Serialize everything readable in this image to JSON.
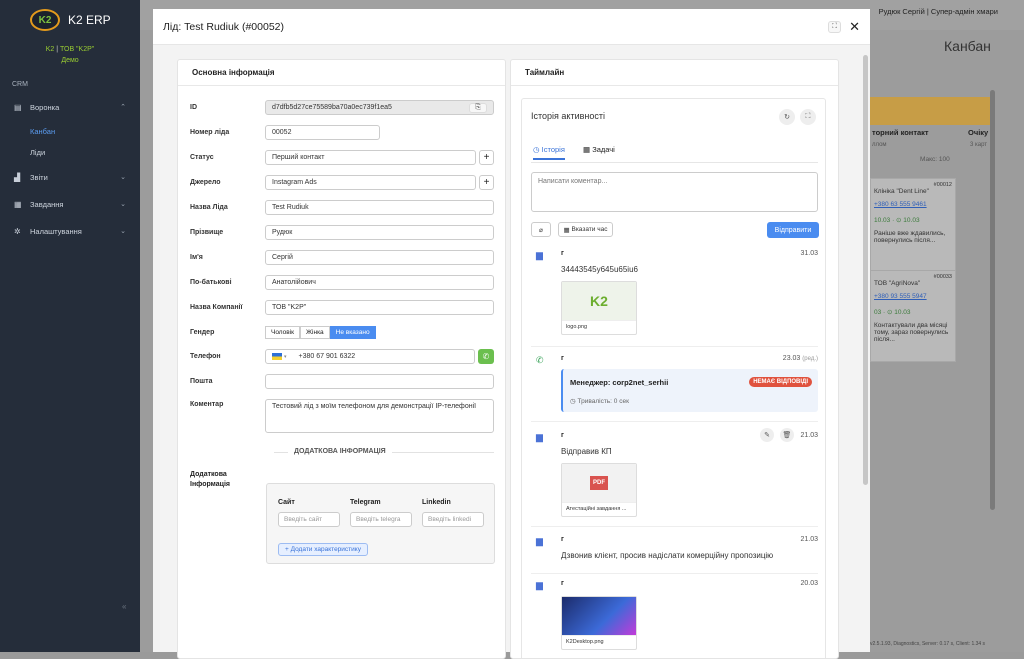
{
  "app": {
    "name": "K2 ERP",
    "org_code": "K2",
    "org_sep": "|",
    "org_name": "ТОВ \"K2P\"",
    "org_mode": "Демо",
    "user": "Рудюк Сергій | Супер-адмін хмари"
  },
  "sidebar": {
    "section": "CRM",
    "items": [
      {
        "label": "Воронка",
        "icon": "funnel-icon"
      },
      {
        "label": "Канбан"
      },
      {
        "label": "Ліди"
      },
      {
        "label": "Звіти",
        "icon": "chart-icon"
      },
      {
        "label": "Завдання",
        "icon": "calendar-icon"
      },
      {
        "label": "Налаштування",
        "icon": "gear-icon"
      }
    ]
  },
  "background": {
    "title": "Канбан",
    "col1": "торний контакт",
    "col1_sub": "ллом",
    "col1_max": "Макс: 100",
    "col2": "Очіку",
    "col2_sub": "3 карт",
    "cards": [
      {
        "id": "#00012",
        "name": "Клініка \"Dent Line\"",
        "phone": "+380 63 555 9461",
        "dates": "10.03 · ⊙ 10.03",
        "note": "Раніше вже ждавились, повернулись після..."
      },
      {
        "id": "#00033",
        "name": "ТОВ \"AgriNova\"",
        "phone": "+380 93 555 5947",
        "dates": "03 · ⊙ 10.03",
        "note": "Контактували два місяці тому, зараз повернулись після..."
      }
    ],
    "footer": "v2.5.1.93, Diagnostics, Server: 0.17 s, Client: 1.34 s"
  },
  "modal": {
    "title": "Лід: Test Rudiuk (#00052)",
    "left": {
      "title": "Основна інформація",
      "fields": {
        "id_label": "ID",
        "id_value": "d7dfb5d27ce75589ba70a0ec739f1ea5",
        "number_label": "Номер ліда",
        "number_value": "00052",
        "status_label": "Статус",
        "status_value": "Перший контакт",
        "source_label": "Джерело",
        "source_value": "Instagram Ads",
        "name_label": "Назва Ліда",
        "name_value": "Test Rudiuk",
        "surname_label": "Прізвище",
        "surname_value": "Рудюк",
        "first_label": "Ім'я",
        "first_value": "Сергій",
        "middle_label": "По-батькові",
        "middle_value": "Анатолійович",
        "company_label": "Назва Компанії",
        "company_value": "ТОВ \"K2P\"",
        "gender_label": "Гендер",
        "gender_male": "Чоловік",
        "gender_female": "Жінка",
        "gender_none": "Не вказано",
        "phone_label": "Телефон",
        "phone_value": "+380 67 901 6322",
        "email_label": "Пошта",
        "email_value": "",
        "comment_label": "Коментар",
        "comment_value": "Тестовий лід з моїм телефоном для демонстрації IP-телефонії"
      },
      "extra_title": "ДОДАТКОВА ІНФОРМАЦІЯ",
      "extra_label": "Додаткова Інформація",
      "extra_cols": [
        {
          "head": "Сайт",
          "placeholder": "Введіть сайт"
        },
        {
          "head": "Telegram",
          "placeholder": "Введіть telegra"
        },
        {
          "head": "Linkedin",
          "placeholder": "Введіть linkedi"
        }
      ],
      "add_char": "+ Додати характеристику"
    },
    "right": {
      "title": "Таймлайн",
      "history_title": "Історія активності",
      "tab_history": "Історія",
      "tab_tasks": "Задачі",
      "comment_placeholder": "Написати коментар...",
      "time_btn": "Вказати час",
      "send_btn": "Відправити",
      "entries": [
        {
          "name": "г",
          "date": "31.03",
          "text": "34443545у645u65iu6",
          "file": "logo.png"
        },
        {
          "name": "г",
          "date": "23.03",
          "date_note": "(ред.)",
          "manager": "Менеджер: corp2net_serhii",
          "status": "НЕМАЄ ВІДПОВІДІ",
          "duration": "Тривалість: 0 сек"
        },
        {
          "name": "г",
          "date": "21.03",
          "text": "Відправив КП",
          "file": "Атестаційні завдання ..."
        },
        {
          "name": "г",
          "date": "21.03",
          "text": "Дзвонив клієнт, просив надіслати комерційну пропозицію"
        },
        {
          "name": "г",
          "date": "20.03",
          "file": "K2Desktop.png"
        }
      ]
    }
  }
}
